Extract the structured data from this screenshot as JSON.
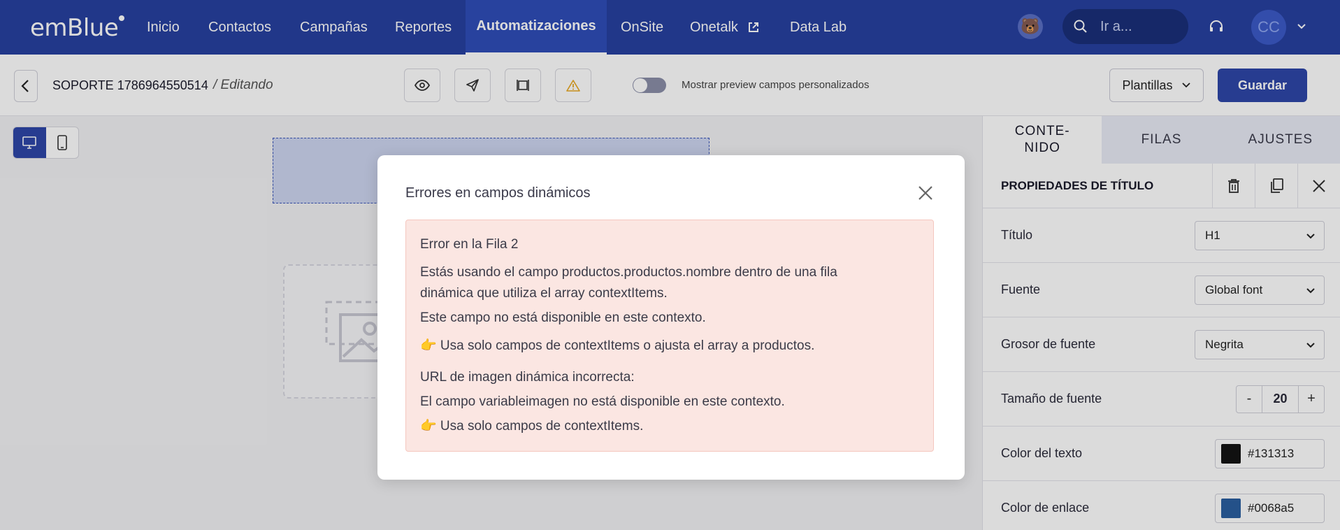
{
  "app": {
    "logo": "emBlue"
  },
  "nav": {
    "items": [
      {
        "label": "Inicio"
      },
      {
        "label": "Contactos"
      },
      {
        "label": "Campañas"
      },
      {
        "label": "Reportes"
      },
      {
        "label": "Automatizaciones",
        "active": true
      },
      {
        "label": "OnSite"
      },
      {
        "label": "Onetalk",
        "external": true
      },
      {
        "label": "Data Lab"
      }
    ],
    "search_placeholder": "Ir a...",
    "user_initials": "CC"
  },
  "toolbar": {
    "campaign_name": "SOPORTE 1786964550514",
    "status": "/ Editando",
    "toggle_label": "Mostrar preview campos personalizados",
    "toggle_on": false,
    "templates_label": "Plantillas",
    "save_label": "Guardar"
  },
  "panel": {
    "tabs": [
      {
        "label": "CONTE-\nNIDO",
        "active": true
      },
      {
        "label": "FILAS"
      },
      {
        "label": "AJUSTES"
      }
    ],
    "props_title": "PROPIEDADES DE TÍTULO",
    "rows": {
      "title": {
        "label": "Título",
        "value": "H1"
      },
      "font": {
        "label": "Fuente",
        "value": "Global font"
      },
      "weight": {
        "label": "Grosor de fuente",
        "value": "Negrita"
      },
      "size": {
        "label": "Tamaño de fuente",
        "value": "20",
        "minus": "-",
        "plus": "+"
      },
      "text_color": {
        "label": "Color del texto",
        "value": "#131313",
        "swatch": "#131313"
      },
      "link_color": {
        "label": "Color de enlace",
        "value": "#0068a5",
        "swatch": "#2a5fa0"
      }
    }
  },
  "modal": {
    "title": "Errores en campos dinámicos",
    "error_heading": "Error en la Fila 2",
    "line1": "Estás usando el campo productos.productos.nombre dentro de una fila",
    "line2": "dinámica que utiliza el array contextItems.",
    "line3": "Este campo no está disponible en este contexto.",
    "line4": "👉 Usa solo campos de contextItems o ajusta el array a productos.",
    "line5": "URL de imagen dinámica incorrecta:",
    "line6": "El campo variableimagen no está disponible en este contexto.",
    "line7": "👉 Usa solo campos de contextItems."
  }
}
